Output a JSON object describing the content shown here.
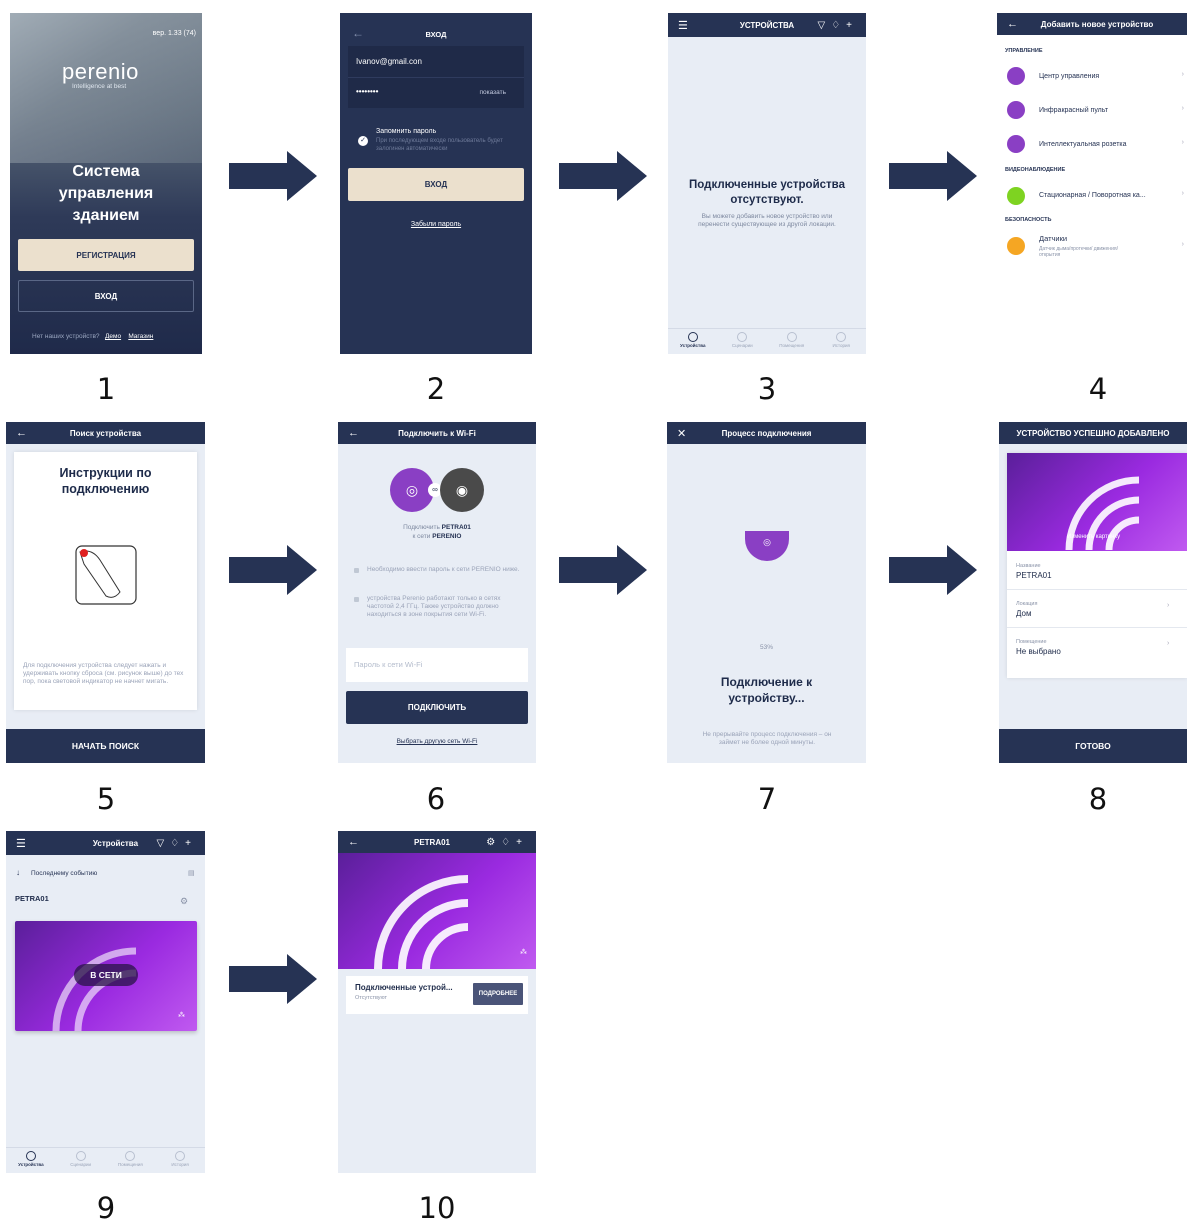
{
  "labels": [
    "1",
    "2",
    "3",
    "4",
    "5",
    "6",
    "7",
    "8",
    "9",
    "10"
  ],
  "s1": {
    "version": "вер. 1.33 (74)",
    "logo": "perenio",
    "tagline": "Intelligence at best",
    "title_l1": "Система",
    "title_l2": "управления",
    "title_l3": "зданием",
    "register": "РЕГИСТРАЦИЯ",
    "login": "ВХОД",
    "no_devices": "Нет наших устройств?",
    "demo": "Демо",
    "shop": "Магазин"
  },
  "s2": {
    "title": "ВХОД",
    "email": "Ivanov@gmail.con",
    "password": "••••••••",
    "show": "показать",
    "remember": "Запомнить пароль",
    "remember_hint": "При последующем входе пользователь будет залогинен автоматически",
    "login_btn": "ВХОД",
    "forgot": "Забыли пароль"
  },
  "s3": {
    "title": "УСТРОЙСТВА",
    "empty_title": "Подключенные устройства отсутствуют.",
    "empty_text": "Вы можете добавить новое устройство или перенести существующее из другой локации.",
    "tabs": [
      "Устройства",
      "Сценарии",
      "Помещения",
      "История"
    ]
  },
  "s4": {
    "title": "Добавить новое устройство",
    "sec1": "УПРАВЛЕНИЕ",
    "item1": "Центр управления",
    "item2": "Инфракрасный пульт",
    "item3": "Интеллектуальная розетка",
    "sec2": "ВИДЕОНАБЛЮДЕНИЕ",
    "item4": "Стационарная / Поворотная ка...",
    "sec3": "БЕЗОПАСНОСТЬ",
    "item5": "Датчики",
    "item5_sub": "Датчик дыма/протечки/ движения/открытия",
    "colors": {
      "hub": "#8a3fc4",
      "ir": "#8a3fc4",
      "plug": "#8a3fc4",
      "camera": "#7ed321",
      "sensor": "#f5a623"
    }
  },
  "s5": {
    "title": "Поиск устройства",
    "heading": "Инструкции по подключению",
    "text": "Для подключения устройства следует нажать и удерживать кнопку сброса (см. рисунок выше) до тех пор, пока световой индикатор не начнет мигать.",
    "btn": "НАЧАТЬ ПОИСК"
  },
  "s6": {
    "title": "Подключить к Wi-Fi",
    "connect_prefix": "Подключить",
    "device": "PETRA01",
    "net_prefix": "к сети",
    "network": "PERENIO",
    "note1": "Необходимо ввести пароль к сети PERENIO ниже.",
    "note2": "устройства Perenio работают только в сетях частотой 2,4 ГГц. Также устройство должно находиться в зоне покрытия сети Wi-Fi.",
    "placeholder": "Пароль к сети Wi-Fi",
    "btn": "ПОДКЛЮЧИТЬ",
    "other": "Выбрать другую сеть Wi-Fi"
  },
  "s7": {
    "title": "Процесс подключения",
    "percent": "53%",
    "heading": "Подключение к устройству...",
    "note": "Не прерывайте процесс подключения – он займет не более одной минуты."
  },
  "s8": {
    "title": "УСТРОЙСТВО УСПЕШНО ДОБАВЛЕНО",
    "change_pic": "Изменить картинку",
    "name_label": "Название",
    "name": "PETRA01",
    "loc_label": "Локация",
    "loc": "Дом",
    "room_label": "Помещение",
    "room": "Не выбрано",
    "btn": "ГОТОВО"
  },
  "s9": {
    "title": "Устройства",
    "sort": "Последнему событию",
    "device": "PETRA01",
    "status": "В СЕТИ",
    "tabs": [
      "Устройства",
      "Сценарии",
      "Помещения",
      "История"
    ]
  },
  "s10": {
    "title": "PETRA01",
    "card_title": "Подключенные устрой...",
    "card_sub": "Отсутствуют",
    "more": "ПОДРОБНЕЕ"
  }
}
